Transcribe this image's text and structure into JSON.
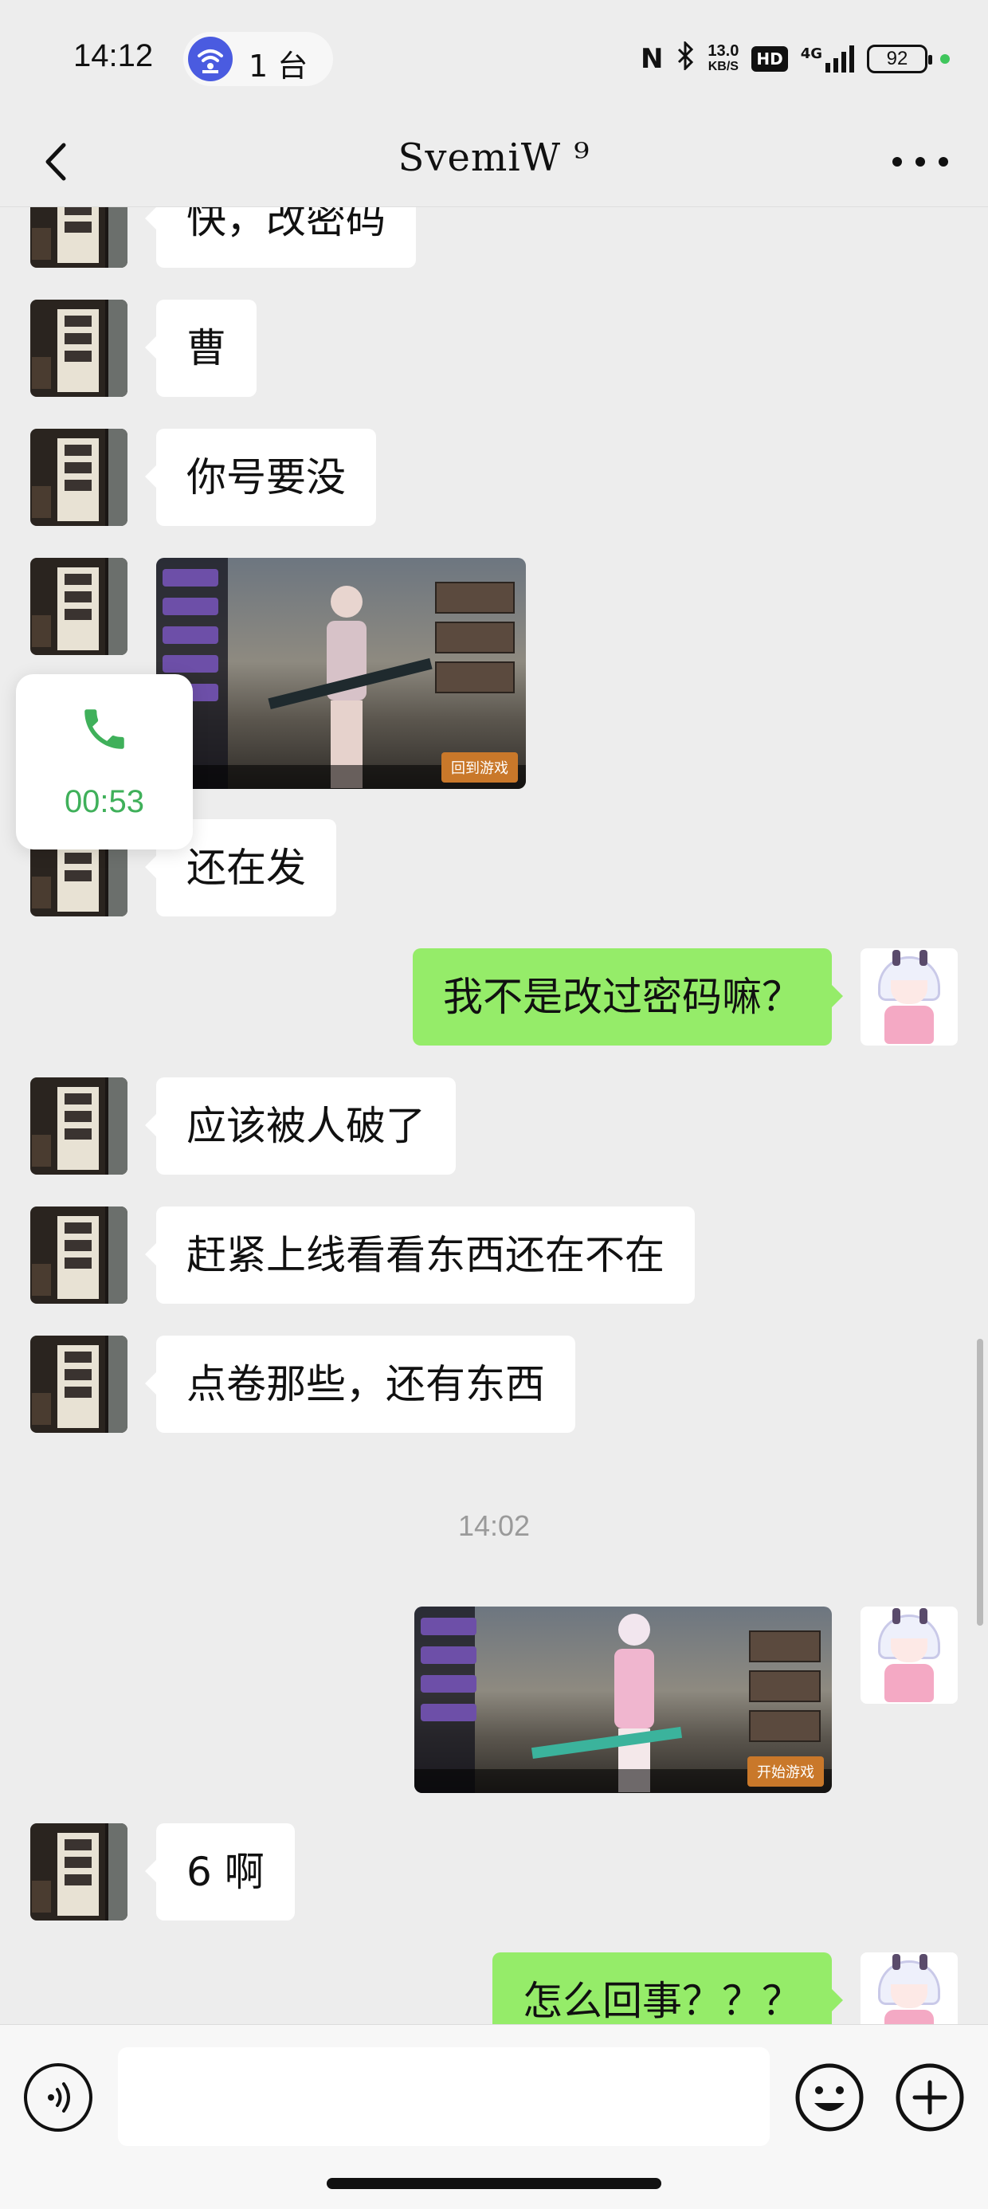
{
  "status_bar": {
    "time": "14:12",
    "hotspot_label": "1 台",
    "speed_value": "13.0",
    "speed_unit": "KB/S",
    "hd_label": "HD",
    "network_label": "4G",
    "battery_level": "92",
    "icons": [
      "wifi-hotspot-icon",
      "nfc-icon",
      "bluetooth-icon",
      "signal-icon",
      "battery-icon"
    ]
  },
  "nav": {
    "title": "SvemiW ⁹",
    "back_icon": "chevron-left-icon",
    "more_icon": "ellipsis-icon"
  },
  "messages": [
    {
      "side": "in",
      "type": "text",
      "text": "快，改密码"
    },
    {
      "side": "in",
      "type": "text",
      "text": "曹"
    },
    {
      "side": "in",
      "type": "text",
      "text": "你号要没"
    },
    {
      "side": "in",
      "type": "image",
      "play_label": "回到游戏"
    },
    {
      "side": "in",
      "type": "text",
      "text": "还在发"
    },
    {
      "side": "out",
      "type": "text",
      "text": "我不是改过密码嘛？"
    },
    {
      "side": "in",
      "type": "text",
      "text": "应该被人破了"
    },
    {
      "side": "in",
      "type": "text",
      "text": "赶紧上线看看东西还在不在"
    },
    {
      "side": "in",
      "type": "text",
      "text": "点卷那些，还有东西"
    },
    {
      "side": "out",
      "type": "image",
      "play_label": "开始游戏"
    },
    {
      "side": "in",
      "type": "text",
      "text": "6 啊"
    },
    {
      "side": "out",
      "type": "text",
      "text": "怎么回事？？？"
    }
  ],
  "timestamp": "14:02",
  "call_widget": {
    "duration": "00:53",
    "icon": "phone-icon",
    "accent": "#3fb05a"
  },
  "input_bar": {
    "voice_icon": "voice-icon",
    "emoji_icon": "emoji-icon",
    "plus_icon": "plus-icon",
    "placeholder": ""
  },
  "colors": {
    "background": "#ededed",
    "outgoing_bubble": "#95ec69",
    "incoming_bubble": "#ffffff"
  }
}
